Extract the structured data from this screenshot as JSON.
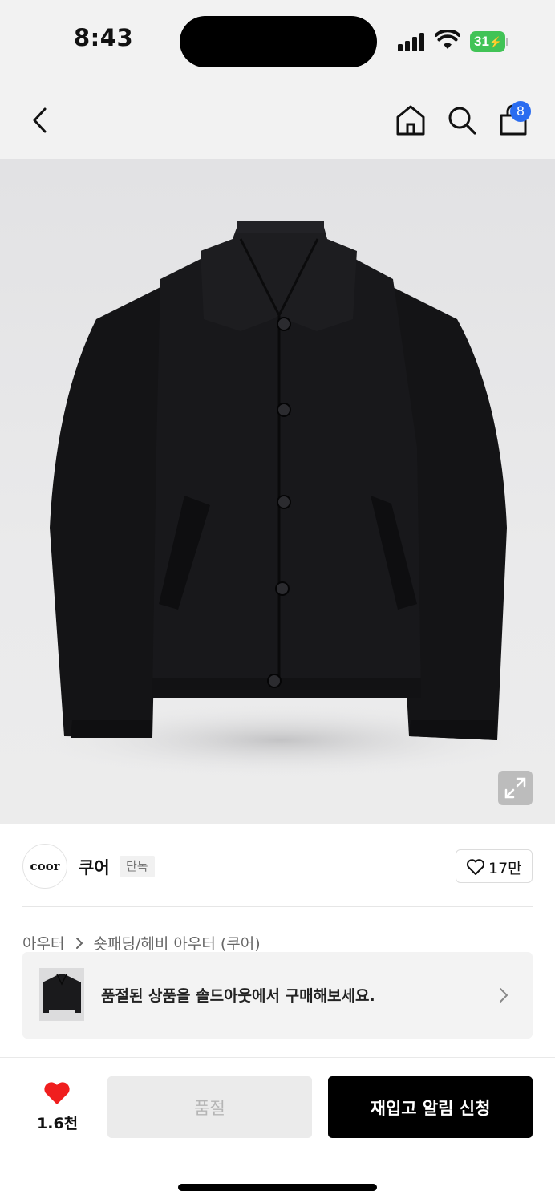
{
  "status_bar": {
    "time": "8:43",
    "battery_level": "31",
    "battery_color": "#41c356",
    "signal_icon": "cellular-signal-icon",
    "wifi_icon": "wifi-icon",
    "battery_icon": "battery-charging-icon"
  },
  "nav": {
    "back_icon": "chevron-left-icon",
    "home_icon": "home-icon",
    "search_icon": "search-icon",
    "cart_icon": "shopping-bag-icon",
    "cart_count": "8",
    "badge_color": "#2a6cf0"
  },
  "product": {
    "image_subject": "black button-front collared jacket",
    "expand_icon": "expand-arrows-icon"
  },
  "brand": {
    "logo_text": "coor",
    "name": "쿠어",
    "tag": "단독",
    "like_icon": "heart-outline-icon",
    "like_count": "17만"
  },
  "breadcrumb": {
    "items": [
      "아우터",
      "숏패딩/헤비 아우터 (쿠어)"
    ],
    "separator_icon": "chevron-right-icon"
  },
  "soldout_banner": {
    "text": "품절된 상품을 솔드아웃에서 구매해보세요.",
    "chevron_icon": "chevron-right-icon"
  },
  "bottom_bar": {
    "wish_icon": "heart-filled-icon",
    "wish_color": "#f01e1e",
    "wish_count": "1.6천",
    "soldout_label": "품절",
    "restock_label": "재입고 알림 신청"
  }
}
